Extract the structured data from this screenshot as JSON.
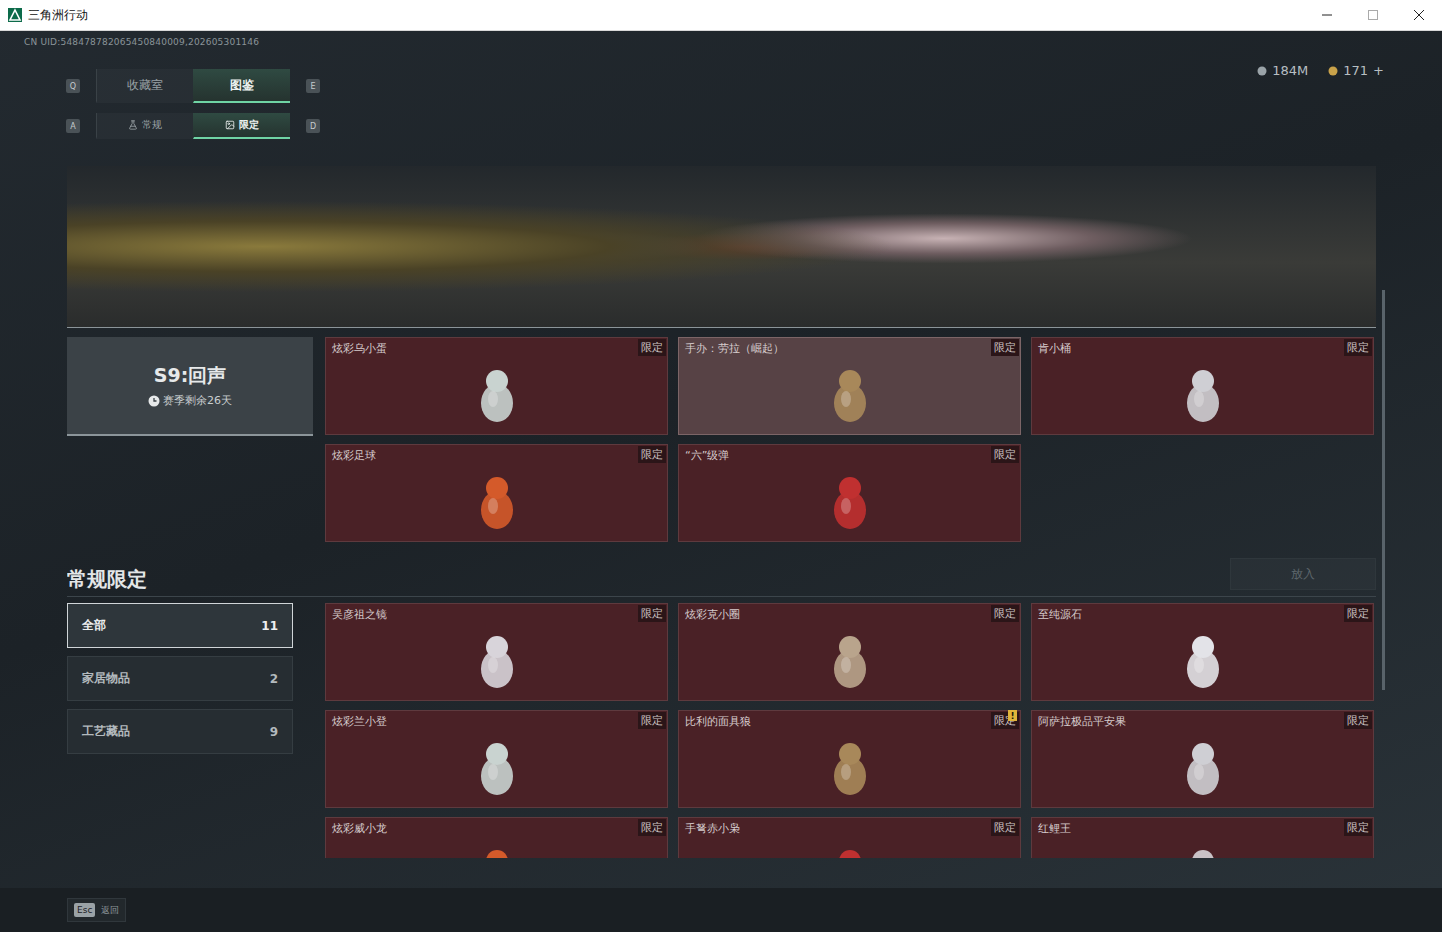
{
  "window": {
    "title": "三角洲行动"
  },
  "uid": "CN UID:548478782065450840009,202605301146",
  "currency": [
    {
      "value": "184M",
      "color": "#9aa3a8"
    },
    {
      "value": "171",
      "color": "#c9a24a"
    }
  ],
  "currency_add": "+",
  "tabs": {
    "prev_key": "Q",
    "next_key": "E",
    "items": [
      {
        "label": "收藏室",
        "selected": false
      },
      {
        "label": "图鉴",
        "selected": true
      }
    ]
  },
  "subtabs": {
    "prev_key": "A",
    "next_key": "D",
    "items": [
      {
        "label": "常规",
        "selected": false
      },
      {
        "label": "限定",
        "selected": true
      }
    ]
  },
  "season": {
    "title": "S9:回声",
    "remaining": "赛季剩余26天",
    "items": [
      {
        "name": "炫彩乌小蛋",
        "badge": "限定",
        "selected": false,
        "alert": false
      },
      {
        "name": "手办：劳拉（崛起）",
        "badge": "限定",
        "selected": true,
        "alert": false
      },
      {
        "name": "肯小桶",
        "badge": "限定",
        "selected": false,
        "alert": false
      },
      {
        "name": "炫彩足球",
        "badge": "限定",
        "selected": false,
        "alert": false
      },
      {
        "name": "“六”级弹",
        "badge": "限定",
        "selected": false,
        "alert": false
      }
    ]
  },
  "section": {
    "title": "常规限定",
    "action": {
      "label": "放入",
      "disabled": true
    }
  },
  "categories": [
    {
      "label": "全部",
      "count": "11",
      "selected": true
    },
    {
      "label": "家居物品",
      "count": "2",
      "selected": false
    },
    {
      "label": "工艺藏品",
      "count": "9",
      "selected": false
    }
  ],
  "items": [
    {
      "name": "吴彦祖之镜",
      "badge": "限定",
      "selected": false,
      "alert": false
    },
    {
      "name": "炫彩克小圈",
      "badge": "限定",
      "selected": false,
      "alert": false
    },
    {
      "name": "至纯源石",
      "badge": "限定",
      "selected": false,
      "alert": false
    },
    {
      "name": "炫彩兰小登",
      "badge": "限定",
      "selected": false,
      "alert": false
    },
    {
      "name": "比利的面具狼",
      "badge": "限定",
      "selected": false,
      "alert": true
    },
    {
      "name": "阿萨拉极品平安果",
      "badge": "限定",
      "selected": false,
      "alert": false
    },
    {
      "name": "炫彩威小龙",
      "badge": "限定",
      "selected": false,
      "alert": false
    },
    {
      "name": "手弩赤小枭",
      "badge": "限定",
      "selected": false,
      "alert": false
    },
    {
      "name": "红鲤王",
      "badge": "限定",
      "selected": false,
      "alert": false
    }
  ],
  "alert_mark": "!",
  "footer": {
    "key": "Esc",
    "label": "返回"
  }
}
